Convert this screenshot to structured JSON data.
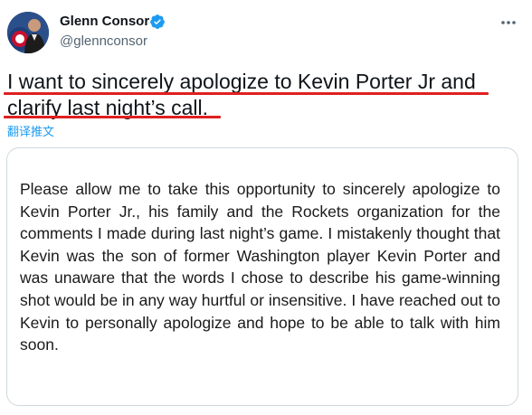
{
  "author": {
    "name": "Glenn Consor",
    "handle": "@glennconsor",
    "verified_icon": "verified-badge-icon",
    "avatar": "avatar"
  },
  "tweet": {
    "text": "I want to sincerely apologize to Kevin Porter Jr and clarify last night’s call.",
    "translate_label": "翻译推文"
  },
  "media": {
    "statement": "Please allow me to take this opportunity to sincerely apologize to Kevin Porter Jr., his family and the Rockets organization for the comments I made during last night’s game. I mistakenly thought that Kevin was the son of former Washington player Kevin Porter and was unaware that the words I chose to describe his game-winning shot would be in any way hurtful or insensitive.  I have reached out to Kevin to personally apologize and hope to be able to talk with him soon."
  },
  "colors": {
    "verified": "#1d9bf0",
    "link": "#1d9bf0",
    "underline_marker": "#e02020",
    "handle": "#536471"
  }
}
